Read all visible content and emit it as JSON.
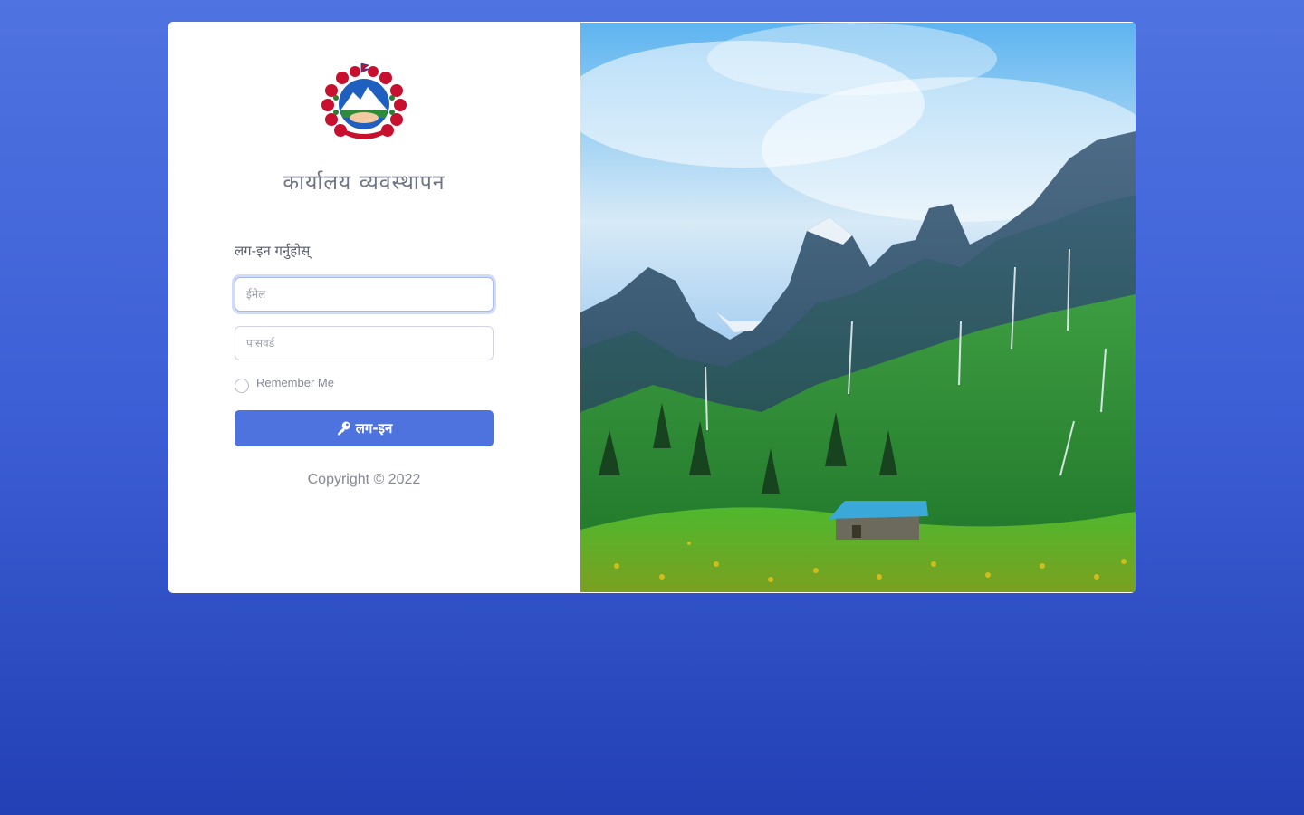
{
  "header": {
    "org_title": "कार्यालय व्यवस्थापन"
  },
  "form": {
    "heading": "लग-इन गर्नुहोस्",
    "username": {
      "placeholder": "ईमेल",
      "value": ""
    },
    "password": {
      "placeholder": "पासवर्ड",
      "value": ""
    },
    "remember_label": "Remember Me",
    "remember_checked": false,
    "login_label": "लग-इन"
  },
  "footer": {
    "copyright": "Copyright © 2022"
  },
  "icons": {
    "emblem": "nepal-emblem-icon",
    "login": "key-icon",
    "hero": "mountain-landscape-image"
  },
  "colors": {
    "background_top": "#4f73e0",
    "background_bottom": "#2340b5",
    "primary": "#4e73df",
    "title_text": "#6e7385"
  }
}
